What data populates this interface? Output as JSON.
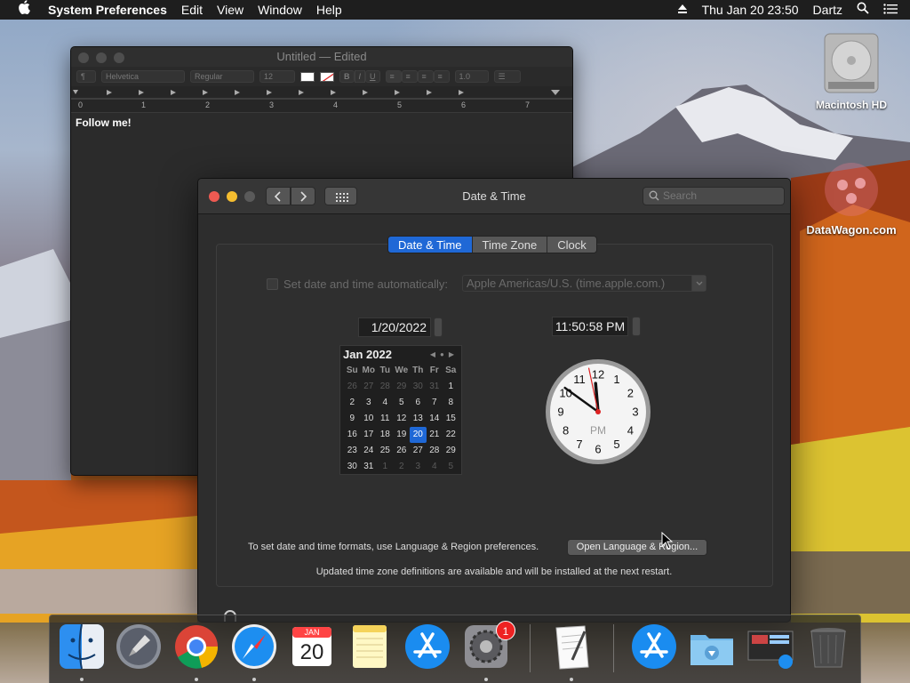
{
  "menubar": {
    "app_name": "System Preferences",
    "menus": [
      "Edit",
      "View",
      "Window",
      "Help"
    ],
    "clock": "Thu Jan 20  23:50",
    "user": "Dartz"
  },
  "desktop": {
    "hd_label": "Macintosh HD",
    "watermark": "DataWagon.com"
  },
  "textedit": {
    "title": "Untitled — Edited",
    "toolbar": {
      "paragraph": "¶",
      "font": "Helvetica",
      "style": "Regular",
      "size": "12",
      "bold": "B",
      "italic": "I",
      "underline": "U",
      "spacing": "1.0"
    },
    "ruler_numbers": [
      "0",
      "1",
      "2",
      "3",
      "4",
      "5",
      "6",
      "7"
    ],
    "body_text": "Follow me!"
  },
  "syspref": {
    "title": "Date & Time",
    "search_placeholder": "Search",
    "tabs": [
      "Date & Time",
      "Time Zone",
      "Clock"
    ],
    "active_tab": "Date & Time",
    "auto_label": "Set date and time automatically:",
    "server": "Apple Americas/U.S. (time.apple.com.)",
    "date_value": "1/20/2022",
    "time_value": "11:50:58 PM",
    "calendar": {
      "month_year": "Jan 2022",
      "dow": [
        "Su",
        "Mo",
        "Tu",
        "We",
        "Th",
        "Fr",
        "Sa"
      ],
      "days": [
        [
          "26",
          "27",
          "28",
          "29",
          "30",
          "31",
          "1"
        ],
        [
          "2",
          "3",
          "4",
          "5",
          "6",
          "7",
          "8"
        ],
        [
          "9",
          "10",
          "11",
          "12",
          "13",
          "14",
          "15"
        ],
        [
          "16",
          "17",
          "18",
          "19",
          "20",
          "21",
          "22"
        ],
        [
          "23",
          "24",
          "25",
          "26",
          "27",
          "28",
          "29"
        ],
        [
          "30",
          "31",
          "1",
          "2",
          "3",
          "4",
          "5"
        ]
      ],
      "today": "20"
    },
    "clock": {
      "numbers": [
        "12",
        "1",
        "2",
        "3",
        "4",
        "5",
        "6",
        "7",
        "8",
        "9",
        "10",
        "11"
      ],
      "ampm": "PM",
      "hours": 11,
      "minutes": 50,
      "seconds": 58
    },
    "formats_text": "To set date and time formats, use Language & Region preferences.",
    "open_button": "Open Language & Region...",
    "tz_note": "Updated time zone definitions are available and will be installed at the next restart."
  },
  "dock": {
    "calendar_month": "JAN",
    "calendar_day": "20",
    "badge": "1",
    "apps": [
      "finder-icon",
      "launchpad-icon",
      "chrome-icon",
      "safari-icon",
      "calendar-icon",
      "notes-icon",
      "app-store-icon",
      "system-preferences-icon",
      "textedit-icon",
      "app-store-icon",
      "downloads-folder-icon",
      "screenshot-icon",
      "trash-icon"
    ]
  }
}
